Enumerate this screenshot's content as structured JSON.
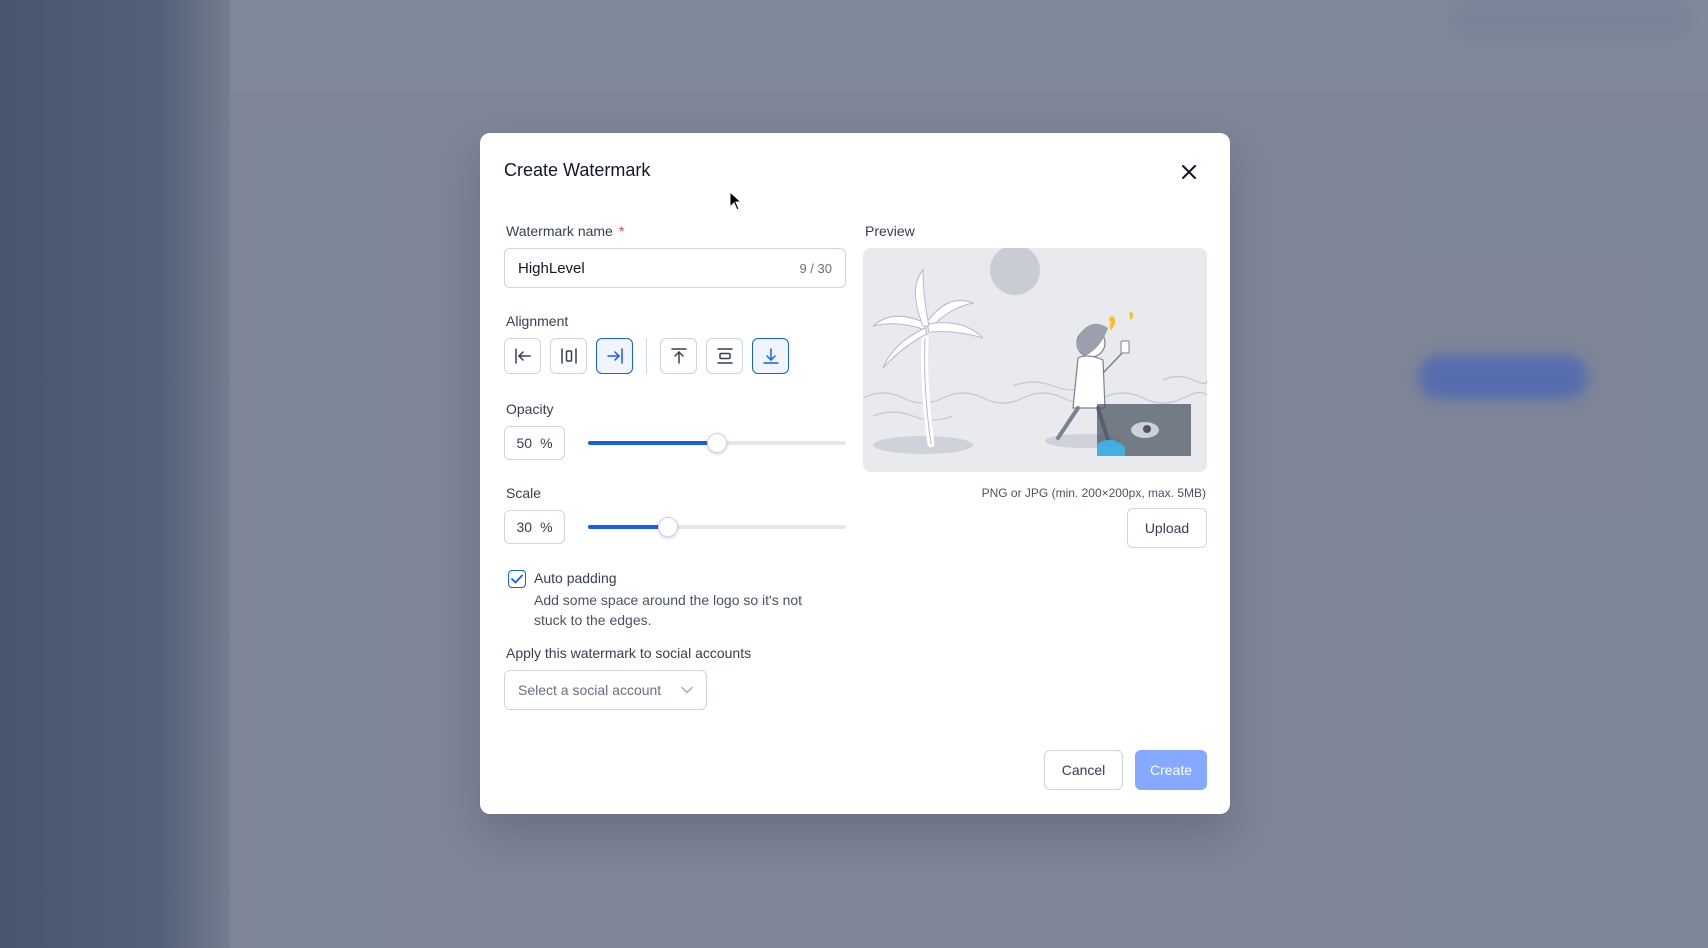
{
  "modal": {
    "title": "Create Watermark",
    "close_icon": "close-icon"
  },
  "name_field": {
    "label": "Watermark name",
    "required_mark": "*",
    "value": "HighLevel",
    "counter": "9 / 30"
  },
  "alignment": {
    "label": "Alignment",
    "horizontal": [
      {
        "icon": "align-left-icon",
        "active": false
      },
      {
        "icon": "align-center-horizontal-icon",
        "active": false
      },
      {
        "icon": "align-right-icon",
        "active": true
      }
    ],
    "vertical": [
      {
        "icon": "align-top-icon",
        "active": false
      },
      {
        "icon": "align-middle-icon",
        "active": false
      },
      {
        "icon": "align-bottom-icon",
        "active": true
      }
    ]
  },
  "opacity": {
    "label": "Opacity",
    "value": "50",
    "unit": "%",
    "fraction": 0.5
  },
  "scale": {
    "label": "Scale",
    "value": "30",
    "unit": "%",
    "fraction": 0.31
  },
  "auto_padding": {
    "checked": true,
    "title": "Auto padding",
    "description": "Add some space around the logo so it's not stuck to the edges."
  },
  "social": {
    "label": "Apply this watermark to social accounts",
    "placeholder": "Select a social account"
  },
  "preview": {
    "label": "Preview",
    "hint": "PNG or JPG (min. 200×200px, max. 5MB)",
    "upload_label": "Upload"
  },
  "footer": {
    "cancel_label": "Cancel",
    "create_label": "Create"
  },
  "colors": {
    "accent": "#155eef",
    "primary_disabled": "#84a9ff",
    "required": "#e5484d"
  }
}
